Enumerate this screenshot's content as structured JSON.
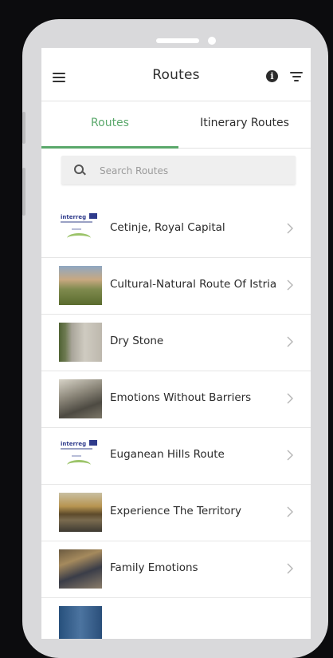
{
  "header": {
    "title": "Routes"
  },
  "tabs": [
    {
      "label": "Routes",
      "active": true
    },
    {
      "label": "Itinerary Routes",
      "active": false
    }
  ],
  "search": {
    "placeholder": "Search Routes",
    "value": ""
  },
  "routes": [
    {
      "label": "Cetinje, Royal Capital",
      "thumb": "interreg-logo"
    },
    {
      "label": "Cultural-Natural Route Of Istria",
      "thumb": "hill-town-photo"
    },
    {
      "label": "Dry Stone",
      "thumb": "stone-wall-photo"
    },
    {
      "label": "Emotions Without Barriers",
      "thumb": "wheelchair-bike-photo"
    },
    {
      "label": "Euganean Hills Route",
      "thumb": "interreg-logo"
    },
    {
      "label": "Experience The Territory",
      "thumb": "sunset-lake-photo"
    },
    {
      "label": "Family Emotions",
      "thumb": "family-photo"
    },
    {
      "label": "",
      "thumb": "blue-banner-photo"
    }
  ],
  "logo_text": {
    "interreg": "interreg"
  },
  "colors": {
    "accent": "#5aa86b",
    "frame": "#d9d9db",
    "background": "#0c0c0e"
  }
}
